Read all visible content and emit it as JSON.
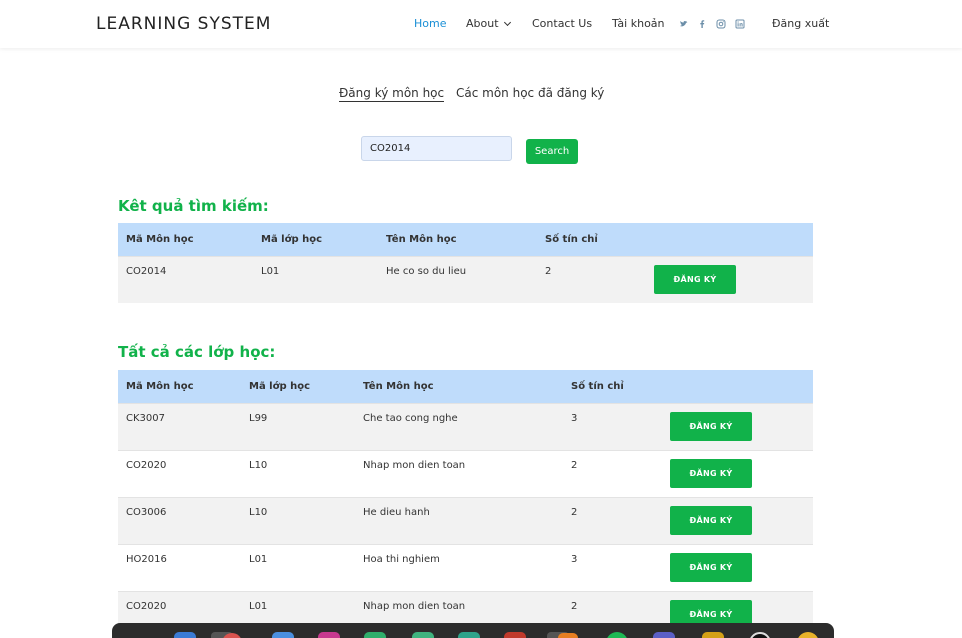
{
  "header": {
    "logo": "LEARNING SYSTEM",
    "nav": [
      "Home",
      "About",
      "Contact Us",
      "Tài khoản"
    ],
    "logout": "Đăng xuất",
    "social_icons": [
      "twitter-icon",
      "facebook-icon",
      "instagram-icon",
      "linkedin-icon"
    ]
  },
  "tabs": {
    "register": "Đăng ký môn học",
    "registered": "Các môn học đã đăng ký"
  },
  "search": {
    "value": "CO2014",
    "button": "Search"
  },
  "results": {
    "title": "Kêt quả tìm kiếm:",
    "headers": [
      "Mã Môn học",
      "Mã lớp học",
      "Tên Môn học",
      "Số tín chỉ"
    ],
    "rows": [
      {
        "code": "CO2014",
        "class": "L01",
        "name": "He co so du lieu",
        "credits": "2",
        "button": "ĐĂNG KÝ"
      }
    ]
  },
  "all_classes": {
    "title": "Tất cả các lớp học:",
    "headers": [
      "Mã Môn học",
      "Mã lớp học",
      "Tên Môn học",
      "Số tín chỉ"
    ],
    "rows": [
      {
        "code": "CK3007",
        "class": "L99",
        "name": "Che tao cong nghe",
        "credits": "3",
        "button": "ĐĂNG KÝ"
      },
      {
        "code": "CO2020",
        "class": "L10",
        "name": "Nhap mon dien toan",
        "credits": "2",
        "button": "ĐĂNG KÝ"
      },
      {
        "code": "CO3006",
        "class": "L10",
        "name": "He dieu hanh",
        "credits": "2",
        "button": "ĐĂNG KÝ"
      },
      {
        "code": "HO2016",
        "class": "L01",
        "name": "Hoa thi nghiem",
        "credits": "3",
        "button": "ĐĂNG KÝ"
      },
      {
        "code": "CO2020",
        "class": "L01",
        "name": "Nhap mon dien toan",
        "credits": "2",
        "button": "ĐĂNG KÝ"
      }
    ]
  },
  "colors": {
    "accent_green": "#11b24a",
    "header_blue": "#bfdcfb",
    "link_blue": "#1a8fd6"
  }
}
